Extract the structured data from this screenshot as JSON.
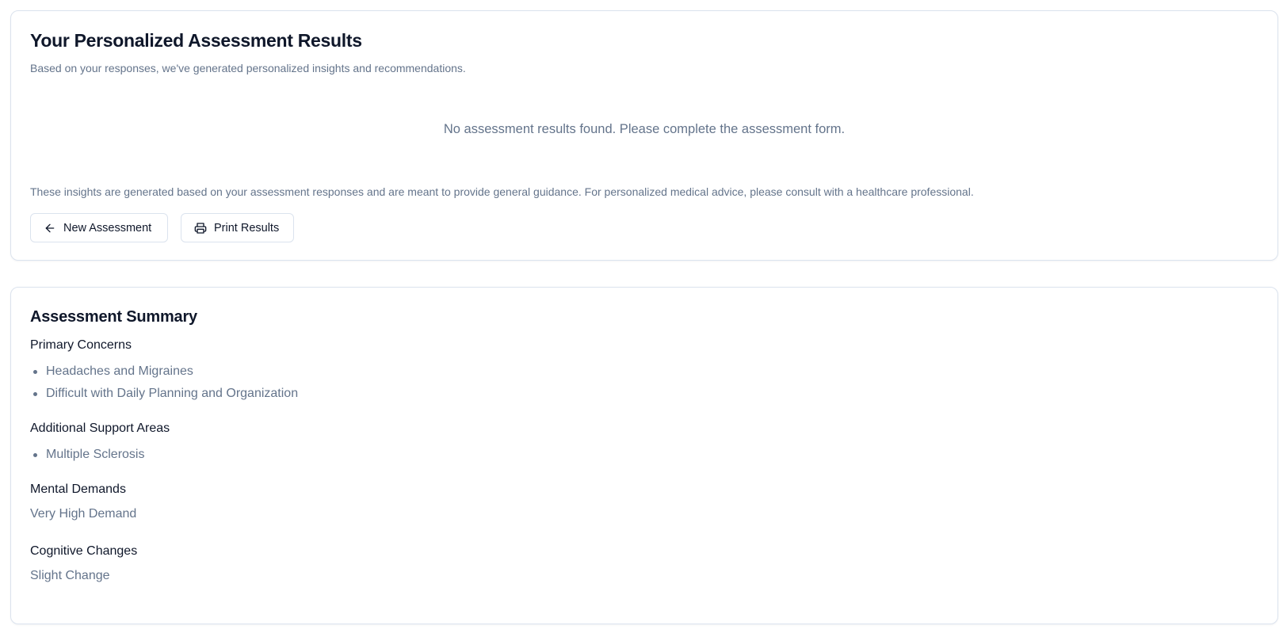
{
  "results": {
    "title": "Your Personalized Assessment Results",
    "subtitle": "Based on your responses, we've generated personalized insights and recommendations.",
    "empty_message": "No assessment results found. Please complete the assessment form.",
    "disclaimer": "These insights are generated based on your assessment responses and are meant to provide general guidance. For personalized medical advice, please consult with a healthcare professional.",
    "buttons": {
      "new_assessment": {
        "label": "New Assessment",
        "icon": "arrow-left-icon"
      },
      "print_results": {
        "label": "Print Results",
        "icon": "printer-icon"
      }
    }
  },
  "summary": {
    "title": "Assessment Summary",
    "primary_concerns": {
      "heading": "Primary Concerns",
      "items": [
        "Headaches and Migraines",
        "Difficult with Daily Planning and Organization"
      ]
    },
    "additional_support": {
      "heading": "Additional Support Areas",
      "items": [
        "Multiple Sclerosis"
      ]
    },
    "mental_demands": {
      "heading": "Mental Demands",
      "value": "Very High Demand"
    },
    "cognitive_changes": {
      "heading": "Cognitive Changes",
      "value": "Slight Change"
    }
  },
  "colors": {
    "heading": "#0f172a",
    "muted_text": "#64748b",
    "border": "#dbe3ee",
    "background": "#ffffff"
  }
}
